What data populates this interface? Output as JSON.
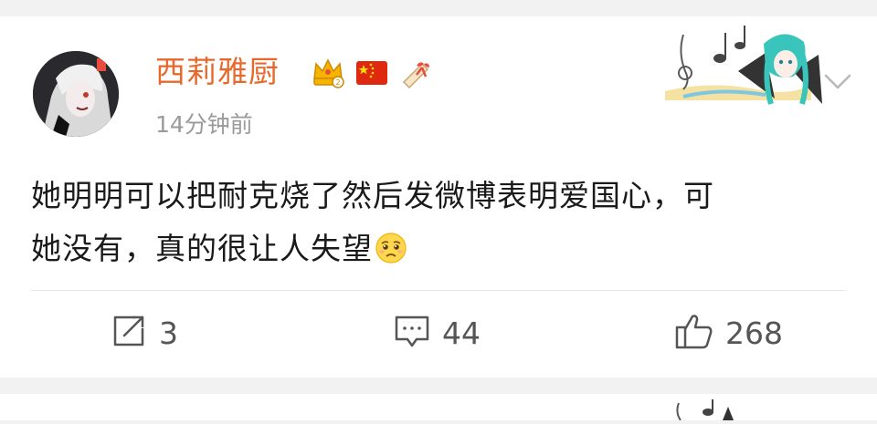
{
  "post": {
    "author": {
      "name": "西莉雅厨",
      "badges": [
        "vip-crown-icon",
        "china-flag-icon",
        "scroll-ribbon-icon"
      ]
    },
    "timestamp": "14分钟前",
    "text_lines": [
      "她明明可以把耐克烧了然后发微博表明爱国心，可",
      "她没有，真的很让人失望"
    ],
    "emoji": "sad-face-emoji",
    "actions": {
      "repost_count": "3",
      "comment_count": "44",
      "like_count": "268"
    }
  },
  "colors": {
    "username": "#e8682c",
    "timestamp": "#9a9a9a",
    "text": "#1a1a1a",
    "action": "#555555",
    "background": "#f2f2f2"
  }
}
